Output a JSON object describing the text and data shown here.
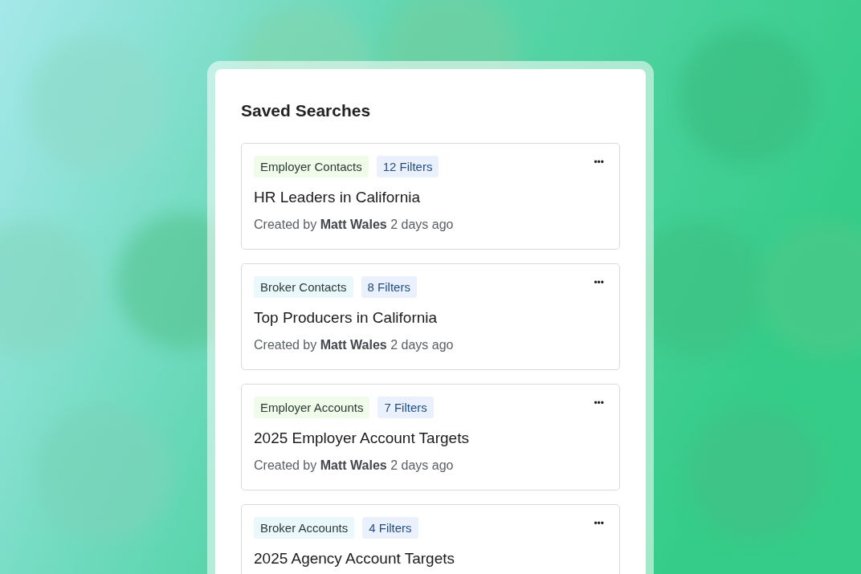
{
  "panel": {
    "title": "Saved Searches",
    "searches": [
      {
        "category": {
          "label": "Employer Contacts",
          "color": "#f1fbea"
        },
        "filters": "12 Filters",
        "more": "•••",
        "name": "HR Leaders in California",
        "meta": {
          "prefix": "Created by",
          "author": "Matt Wales",
          "age": "2 days ago"
        }
      },
      {
        "category": {
          "label": "Broker Contacts",
          "color": "#eaf8fb"
        },
        "filters": "8 Filters",
        "more": "•••",
        "name": "Top Producers in California",
        "meta": {
          "prefix": "Created by",
          "author": "Matt Wales",
          "age": "2 days ago"
        }
      },
      {
        "category": {
          "label": "Employer Accounts",
          "color": "#f1fbea"
        },
        "filters": "7 Filters",
        "more": "•••",
        "name": "2025 Employer Account Targets",
        "meta": {
          "prefix": "Created by",
          "author": "Matt Wales",
          "age": "2 days ago"
        }
      },
      {
        "category": {
          "label": "Broker Accounts",
          "color": "#eaf8fb"
        },
        "filters": "4 Filters",
        "more": "•••",
        "name": "2025 Agency Account Targets"
      }
    ]
  }
}
